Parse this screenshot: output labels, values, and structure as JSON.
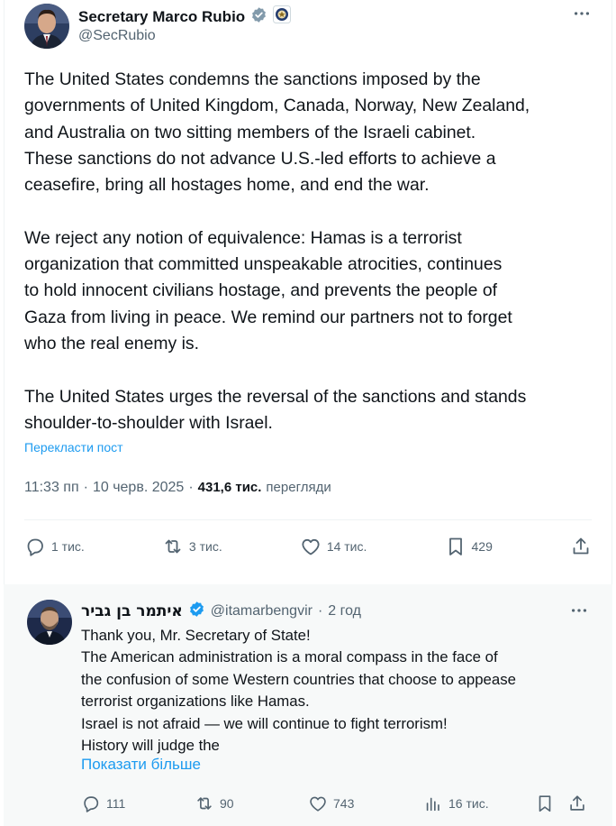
{
  "main_tweet": {
    "display_name": "Secretary Marco Rubio",
    "handle": "@SecRubio",
    "paragraphs": [
      [
        "The United States condemns the sanctions imposed by the",
        "governments of United Kingdom, Canada, Norway, New Zealand,",
        "and Australia on two sitting members of the Israeli cabinet.",
        "These sanctions do not advance U.S.-led efforts to achieve a",
        "ceasefire, bring all hostages home, and end the war."
      ],
      [
        "We reject any notion of equivalence: Hamas is a terrorist",
        "organization that committed unspeakable atrocities, continues",
        "to hold innocent civilians hostage, and prevents the people of",
        "Gaza from living in peace. We remind our partners not to forget",
        "who the real enemy is."
      ],
      [
        "The United States urges the reversal of the sanctions and stands",
        "shoulder-to-shoulder with Israel."
      ]
    ],
    "translate_label": "Перекласти пост",
    "time": "11:33 пп",
    "date": "10 черв. 2025",
    "views_count": "431,6 тис.",
    "views_label": "перегляди",
    "replies": "1 тис.",
    "reposts": "3 тис.",
    "likes": "14 тис.",
    "bookmarks": "429",
    "more_icon": "more-dots-icon"
  },
  "reply_tweet": {
    "display_name": "איתמר בן גביר",
    "handle": "@itamarbengvir",
    "time_ago": "2 год",
    "lines": [
      "Thank you, Mr. Secretary of State!",
      "The American administration is a moral compass in the face of",
      "the confusion of some Western countries that choose to appease",
      "terrorist organizations like Hamas.",
      "Israel is not afraid — we will continue to fight terrorism!",
      "History will judge the"
    ],
    "show_more_label": "Показати більше",
    "replies": "111",
    "reposts": "90",
    "likes": "743",
    "views": "16 тис."
  },
  "colors": {
    "accent": "#1d9bf0",
    "verified": "#1d9bf0",
    "muted_text": "#536471",
    "reply_bg": "#f7f9f9"
  }
}
